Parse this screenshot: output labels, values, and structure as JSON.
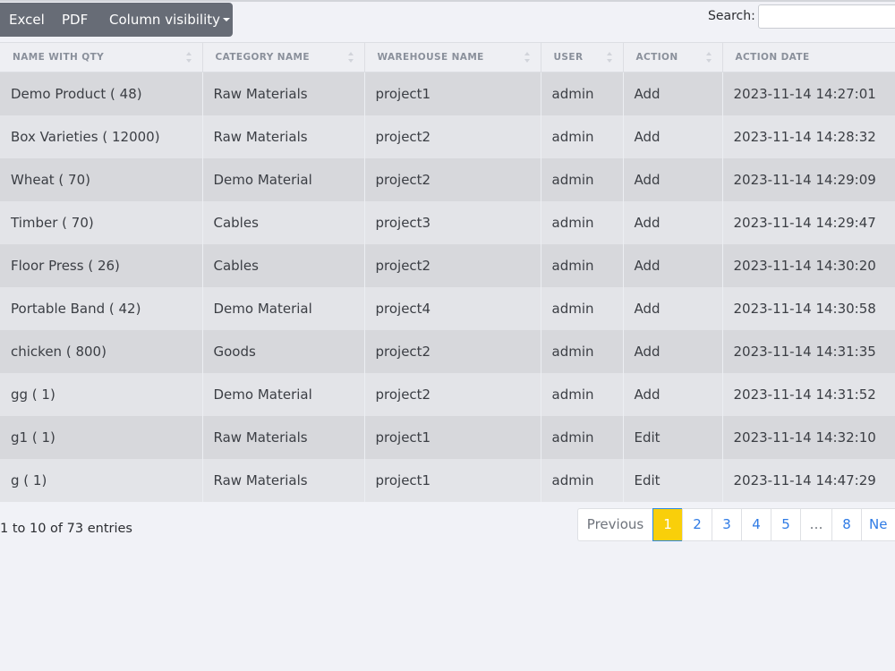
{
  "toolbar": {
    "excel_label": "Excel",
    "pdf_label": "PDF",
    "colvis_label": "Column visibility"
  },
  "search": {
    "label": "Search:",
    "value": ""
  },
  "table": {
    "headers": [
      "NAME WITH QTY",
      "CATEGORY NAME",
      "WAREHOUSE NAME",
      "USER",
      "ACTION",
      "ACTION DATE"
    ],
    "rows": [
      [
        "Demo Product ( 48)",
        "Raw Materials",
        "project1",
        "admin",
        "Add",
        "2023-11-14 14:27:01"
      ],
      [
        "Box Varieties ( 12000)",
        "Raw Materials",
        "project2",
        "admin",
        "Add",
        "2023-11-14 14:28:32"
      ],
      [
        "Wheat ( 70)",
        "Demo Material",
        "project2",
        "admin",
        "Add",
        "2023-11-14 14:29:09"
      ],
      [
        "Timber ( 70)",
        "Cables",
        "project3",
        "admin",
        "Add",
        "2023-11-14 14:29:47"
      ],
      [
        "Floor Press ( 26)",
        "Cables",
        "project2",
        "admin",
        "Add",
        "2023-11-14 14:30:20"
      ],
      [
        "Portable Band ( 42)",
        "Demo Material",
        "project4",
        "admin",
        "Add",
        "2023-11-14 14:30:58"
      ],
      [
        "chicken ( 800)",
        "Goods",
        "project2",
        "admin",
        "Add",
        "2023-11-14 14:31:35"
      ],
      [
        "gg ( 1)",
        "Demo Material",
        "project2",
        "admin",
        "Add",
        "2023-11-14 14:31:52"
      ],
      [
        "g1 ( 1)",
        "Raw Materials",
        "project1",
        "admin",
        "Edit",
        "2023-11-14 14:32:10"
      ],
      [
        "g ( 1)",
        "Raw Materials",
        "project1",
        "admin",
        "Edit",
        "2023-11-14 14:47:29"
      ]
    ]
  },
  "info": "1 to 10 of 73 entries",
  "pagination": {
    "previous": "Previous",
    "pages": [
      "1",
      "2",
      "3",
      "4",
      "5"
    ],
    "ellipsis": "…",
    "last_page": "8",
    "next": "Ne",
    "active": "1"
  },
  "colors": {
    "toolbar_bg": "#676c76",
    "active_page_bg": "#f9cf0a",
    "link": "#2f7be5"
  }
}
